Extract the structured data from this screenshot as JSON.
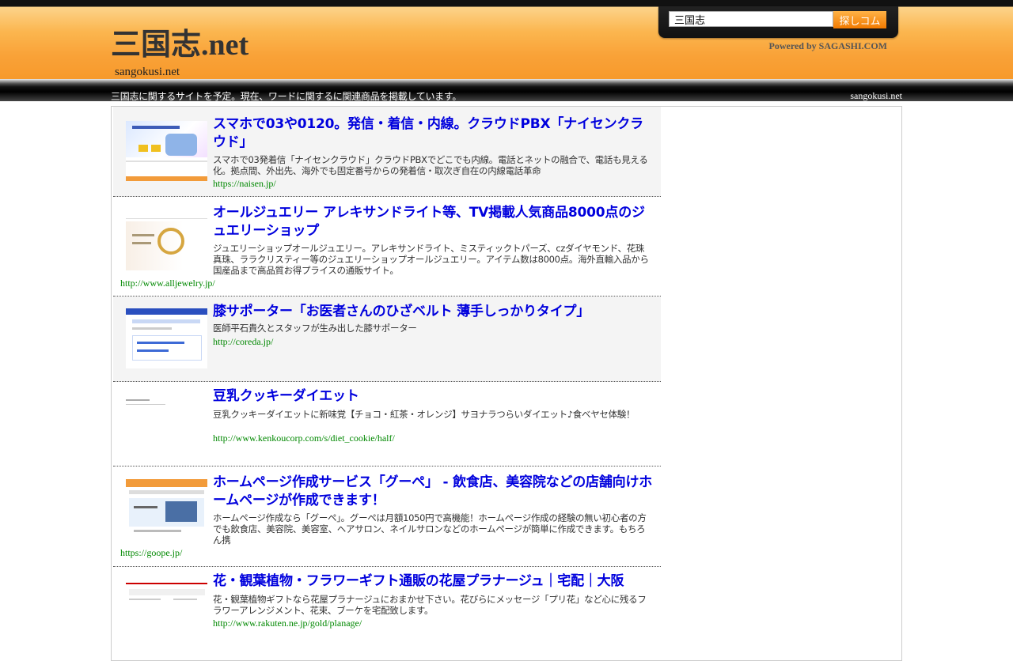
{
  "header": {
    "site_title": "三国志.net",
    "site_subtitle": "sangokusi.net",
    "search": {
      "value": "三国志",
      "button_label": "探しコム"
    },
    "powered_by": "Powered by SAGASHI.COM",
    "tagline": "三国志に関するサイトを予定。現在、ワードに関するに関連商品を掲載しています。",
    "domain_right": "sangokusi.net"
  },
  "results": [
    {
      "title": "スマホで03や0120。発信・着信・内線。クラウドPBX「ナイセンクラウド」",
      "description": "スマホで03発着信「ナイセンクラウド」クラウドPBXでどこでも内線。電話とネットの融合で、電話も見える化。拠点間、外出先、海外でも固定番号からの発着信・取次ぎ自在の内線電話革命",
      "url": "https://naisen.jp/"
    },
    {
      "title": "オールジュエリー アレキサンドライト等、TV掲載人気商品8000点のジュエリーショップ",
      "description": "ジュエリーショップオールジュエリー。アレキサンドライト、ミスティックトパーズ、czダイヤモンド、花珠真珠、ララクリスティー等のジュエリーショップオールジュエリー。アイテム数は8000点。海外直輸入品から国産品まで高品質お得プライスの通販サイト。",
      "url": "http://www.alljewelry.jp/"
    },
    {
      "title": "膝サポーター「お医者さんのひざベルト 薄手しっかりタイプ」",
      "description": "医師平石貴久とスタッフが生み出した膝サポーター",
      "url": "http://coreda.jp/"
    },
    {
      "title": "豆乳クッキーダイエット",
      "description": "豆乳クッキーダイエットに新味覚【チョコ・紅茶・オレンジ】サヨナラつらいダイエット♪食べヤセ体験！",
      "url": "http://www.kenkoucorp.com/s/diet_cookie/half/"
    },
    {
      "title": "ホームページ作成サービス「グーペ」 - 飲食店、美容院などの店舗向けホームページが作成できます！",
      "description": "ホームページ作成なら「グーペ」。グーペは月額1050円で高機能！ホームページ作成の経験の無い初心者の方でも飲食店、美容院、美容室、ヘアサロン、ネイルサロンなどのホームページが簡単に作成できます。もちろん携",
      "url": "https://goope.jp/"
    },
    {
      "title": "花・観葉植物・フラワーギフト通販の花屋プラナージュ｜宅配｜大阪",
      "description": "花・観葉植物ギフトなら花屋プラナージュにおまかせ下さい。花びらにメッセージ「プリ花」など心に残るフラワーアレンジメント、花束、ブーケを宅配致します。",
      "url": "http://www.rakuten.ne.jp/gold/planage/"
    }
  ]
}
